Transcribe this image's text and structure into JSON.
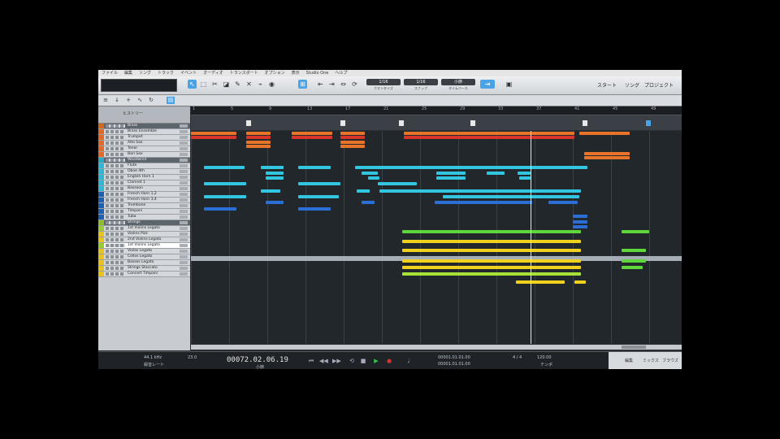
{
  "menu": [
    "ファイル",
    "編集",
    "ソング",
    "トラック",
    "イベント",
    "オーディオ",
    "トランスポート",
    "オプション",
    "表示",
    "Studio One",
    "ヘルプ"
  ],
  "toolbar": {
    "quant_values": [
      "1/16",
      "1/16",
      "小節"
    ],
    "quant_labels": [
      "クオンタイズ",
      "スナップ",
      "タイムベース"
    ],
    "start_label": "スタート",
    "song_label": "ソング",
    "project_label": "プロジェクト"
  },
  "tracklist": {
    "header_label": "ヒストリー",
    "rows": [
      {
        "name": "Brass",
        "type": "folder",
        "color": "#d2691e"
      },
      {
        "name": "Brass Ensemble",
        "type": "track",
        "color": "#e06a2a"
      },
      {
        "name": "Trumpet",
        "type": "track",
        "color": "#e06a2a"
      },
      {
        "name": "Alto Sax",
        "type": "track",
        "color": "#e06a2a"
      },
      {
        "name": "Tenor",
        "type": "track",
        "color": "#e06a2a"
      },
      {
        "name": "Bari Sax",
        "type": "track",
        "color": "#e06a2a"
      },
      {
        "name": "Woodwind",
        "type": "folder",
        "color": "#29a9c9"
      },
      {
        "name": "Flute",
        "type": "track",
        "color": "#2fb7d4"
      },
      {
        "name": "Oboe 4th",
        "type": "track",
        "color": "#2fb7d4"
      },
      {
        "name": "English Horn 1",
        "type": "track",
        "color": "#2fb7d4"
      },
      {
        "name": "Clarinet 1",
        "type": "track",
        "color": "#2fb7d4"
      },
      {
        "name": "Bassoon",
        "type": "track",
        "color": "#2fb7d4"
      },
      {
        "name": "French Horn 1,2",
        "type": "track",
        "color": "#1e5fb0"
      },
      {
        "name": "French Horn 3,4",
        "type": "track",
        "color": "#1e5fb0"
      },
      {
        "name": "Trombone",
        "type": "track",
        "color": "#1e5fb0"
      },
      {
        "name": "Timpani",
        "type": "track",
        "color": "#1e5fb0"
      },
      {
        "name": "Tuba",
        "type": "track",
        "color": "#1e5fb0"
      },
      {
        "name": "Strings",
        "type": "folder",
        "color": "#8cbf2a"
      },
      {
        "name": "1st Violins Legato",
        "type": "track",
        "color": "#9acd32"
      },
      {
        "name": "Violins Pizz",
        "type": "track",
        "color": "#e8c21e"
      },
      {
        "name": "2nd Violins Legato",
        "type": "track",
        "color": "#e8c21e"
      },
      {
        "name": "1st Violins Legato",
        "type": "selected",
        "color": "#9acd32"
      },
      {
        "name": "Violas Legato",
        "type": "track",
        "color": "#e8c21e"
      },
      {
        "name": "Cellos Legato",
        "type": "track",
        "color": "#e8c21e"
      },
      {
        "name": "Basses Legato",
        "type": "track",
        "color": "#e8c21e"
      },
      {
        "name": "Strings Staccato",
        "type": "track",
        "color": "#e8c21e"
      },
      {
        "name": "Concert Timpani",
        "type": "track",
        "color": "#e8c21e"
      }
    ]
  },
  "ruler": {
    "bars": [
      "1",
      "5",
      "9",
      "13",
      "17",
      "21",
      "25",
      "29",
      "33",
      "37",
      "41",
      "45",
      "49"
    ]
  },
  "colors": {
    "orange": "#e8742a",
    "red": "#d9342a",
    "cyan": "#33c6e0",
    "blue": "#2a6ed6",
    "green": "#5fd63a",
    "yellow": "#f0d21e",
    "lime": "#a8e03a"
  },
  "transport": {
    "sample_rate": "44.1 kHz",
    "sample_label": "録音レート",
    "cpu": "23.0",
    "time": "00072.02.06.19",
    "time_unit": "小節",
    "loop_start": "00001.01.01.00",
    "loop_end": "00001.01.01.00",
    "time_sig": "4 / 4",
    "tempo": "120.00",
    "tempo_label": "テンポ",
    "right_labels": [
      "編集",
      "ミックス",
      "ブラウズ"
    ]
  }
}
